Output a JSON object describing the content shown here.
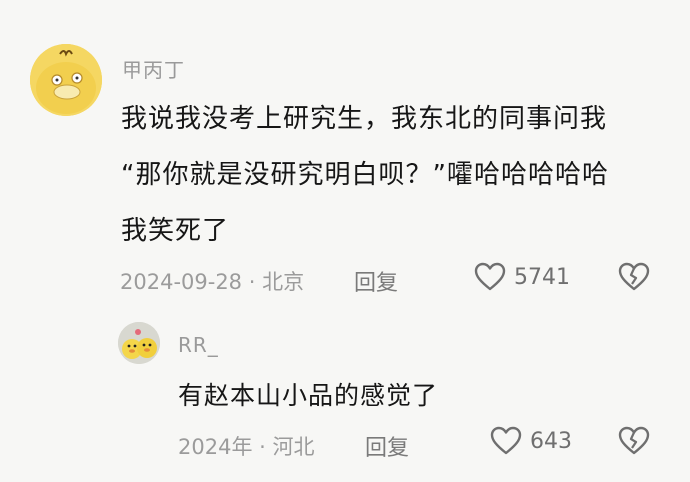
{
  "comment": {
    "username": "甲丙丁",
    "avatar_icon": "psyduck-avatar-icon",
    "lines": [
      "我说我没考上研究生，我东北的同事问我",
      "“那你就是没研究明白呗？”嚯哈哈哈哈哈",
      "我笑死了"
    ],
    "meta": "2024-09-28 · 北京",
    "reply_label": "回复",
    "like_count": "5741"
  },
  "reply": {
    "username": "RR_",
    "avatar_icon": "duck-toys-avatar-icon",
    "text": "有赵本山小品的感觉了",
    "meta": "2024年 · 河北",
    "reply_label": "回复",
    "like_count": "643"
  },
  "colors": {
    "background": "#f7f7f5",
    "text": "#161616",
    "muted": "#9b9b9b",
    "avatar_yellow": "#f3d35a"
  }
}
